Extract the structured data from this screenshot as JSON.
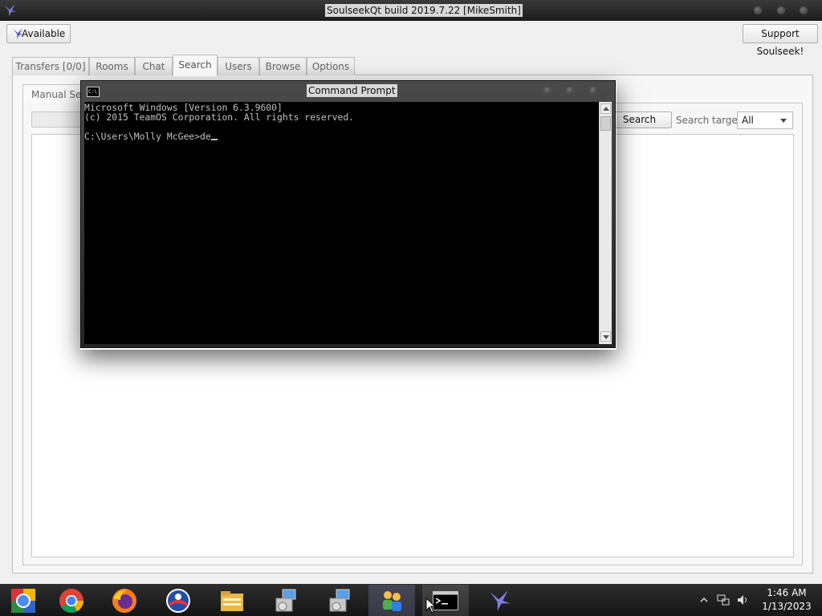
{
  "window": {
    "title": "SoulseekQt build 2019.7.22 [MikeSmith]",
    "status_button": "Available",
    "support_button": "Support Soulseek!"
  },
  "tabs": [
    {
      "label": "Transfers [0/0]",
      "active": false
    },
    {
      "label": "Rooms",
      "active": false
    },
    {
      "label": "Chat",
      "active": false
    },
    {
      "label": "Search",
      "active": true
    },
    {
      "label": "Users",
      "active": false
    },
    {
      "label": "Browse",
      "active": false
    },
    {
      "label": "Options",
      "active": false
    }
  ],
  "search": {
    "subtab_label": "Manual Sear",
    "query": "",
    "search_button": "Search",
    "target_label": "Search target:",
    "target_value": "All"
  },
  "cmd": {
    "title": "Command Prompt",
    "icon_text": "C:\\",
    "lines": [
      "Microsoft Windows [Version 6.3.9600]",
      "(c) 2015 TeamOS Corporation. All rights reserved.",
      "",
      "C:\\Users\\Molly McGee>de"
    ]
  },
  "taskbar": {
    "items": [
      "chrome-grid-icon",
      "chrome-icon",
      "firefox-icon",
      "opera-icon",
      "folder-icon",
      "installer-icon",
      "installer-icon",
      "people-icon",
      "cmd-icon",
      "soulseek-icon"
    ],
    "time": "1:46 AM",
    "date": "1/13/2023"
  },
  "colors": {
    "titlebar": "#1c1c1c",
    "console_bg": "#000000",
    "console_text": "#c0c0c0",
    "panel": "#f7f7f7"
  }
}
